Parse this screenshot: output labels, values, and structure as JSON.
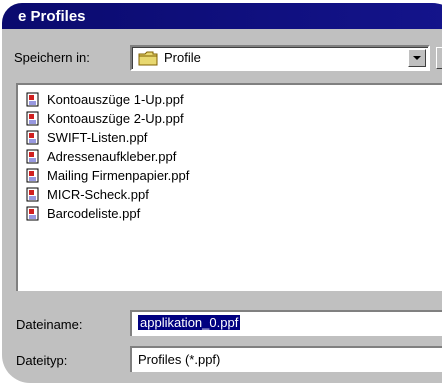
{
  "dialog": {
    "title": "e Profiles"
  },
  "lookin": {
    "label": "Speichern in:",
    "value": "Profile"
  },
  "files": [
    {
      "name": "Kontoauszüge 1-Up.ppf"
    },
    {
      "name": "Kontoauszüge 2-Up.ppf"
    },
    {
      "name": "SWIFT-Listen.ppf"
    },
    {
      "name": "Adressenaufkleber.ppf"
    },
    {
      "name": "Mailing Firmenpapier.ppf"
    },
    {
      "name": "MICR-Scheck.ppf"
    },
    {
      "name": "Barcodeliste.ppf"
    }
  ],
  "filename": {
    "label": "Dateiname:",
    "value": "applikation_0.ppf"
  },
  "filetype": {
    "label": "Dateityp:",
    "value": "Profiles (*.ppf)"
  }
}
